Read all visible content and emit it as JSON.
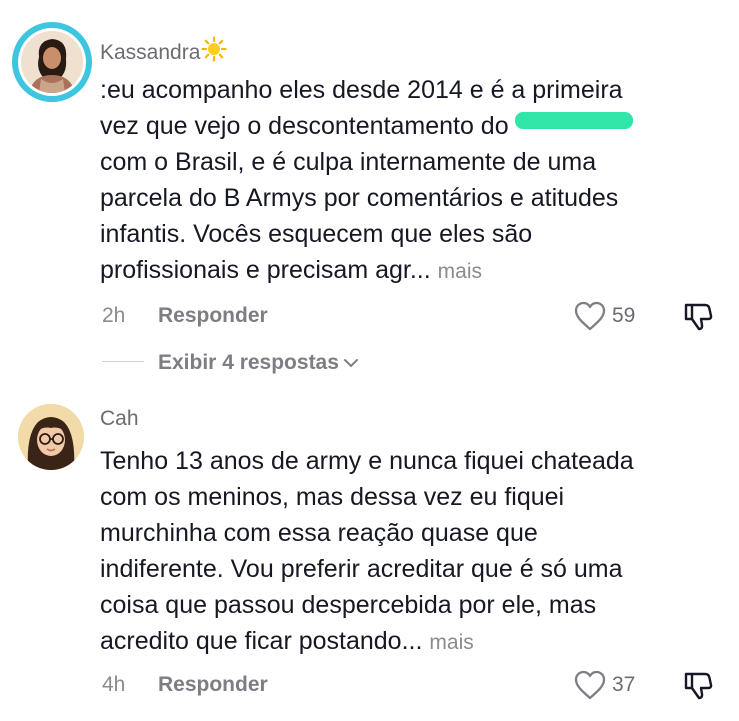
{
  "comments": [
    {
      "username": "Kassandra",
      "text_line1": ":eu acompanho eles desde 2014 e é a primeira",
      "text_line2": "vez que vejo o descontentamento do",
      "text_rest": "com o Brasil, e é culpa internamente de uma\nparcela do B Armys por comentários e atitudes\ninfantis. Vocês esquecem que eles são\nprofissionais e precisam agr...",
      "more_label": "mais",
      "time": "2h",
      "reply_label": "Responder",
      "likes": "59",
      "replies_label": "Exibir 4 respostas"
    },
    {
      "username": "Cah",
      "text": "Tenho 13 anos de army e nunca fiquei chateada\ncom os meninos, mas dessa vez eu fiquei\nmurchinha com essa reação quase que\nindiferente. Vou preferir acreditar que é só uma\ncoisa que passou despercebida por ele, mas\nacredito que ficar postando...",
      "more_label": "mais",
      "time": "4h",
      "reply_label": "Responder",
      "likes": "37"
    }
  ],
  "colors": {
    "story_ring": "#3ec6e0",
    "redaction": "#2fe6a8",
    "secondary_text": "#8a8b91"
  },
  "icons": [
    "sun-emoji-icon",
    "heart-outline-icon",
    "thumbs-down-icon",
    "chevron-down-icon"
  ]
}
